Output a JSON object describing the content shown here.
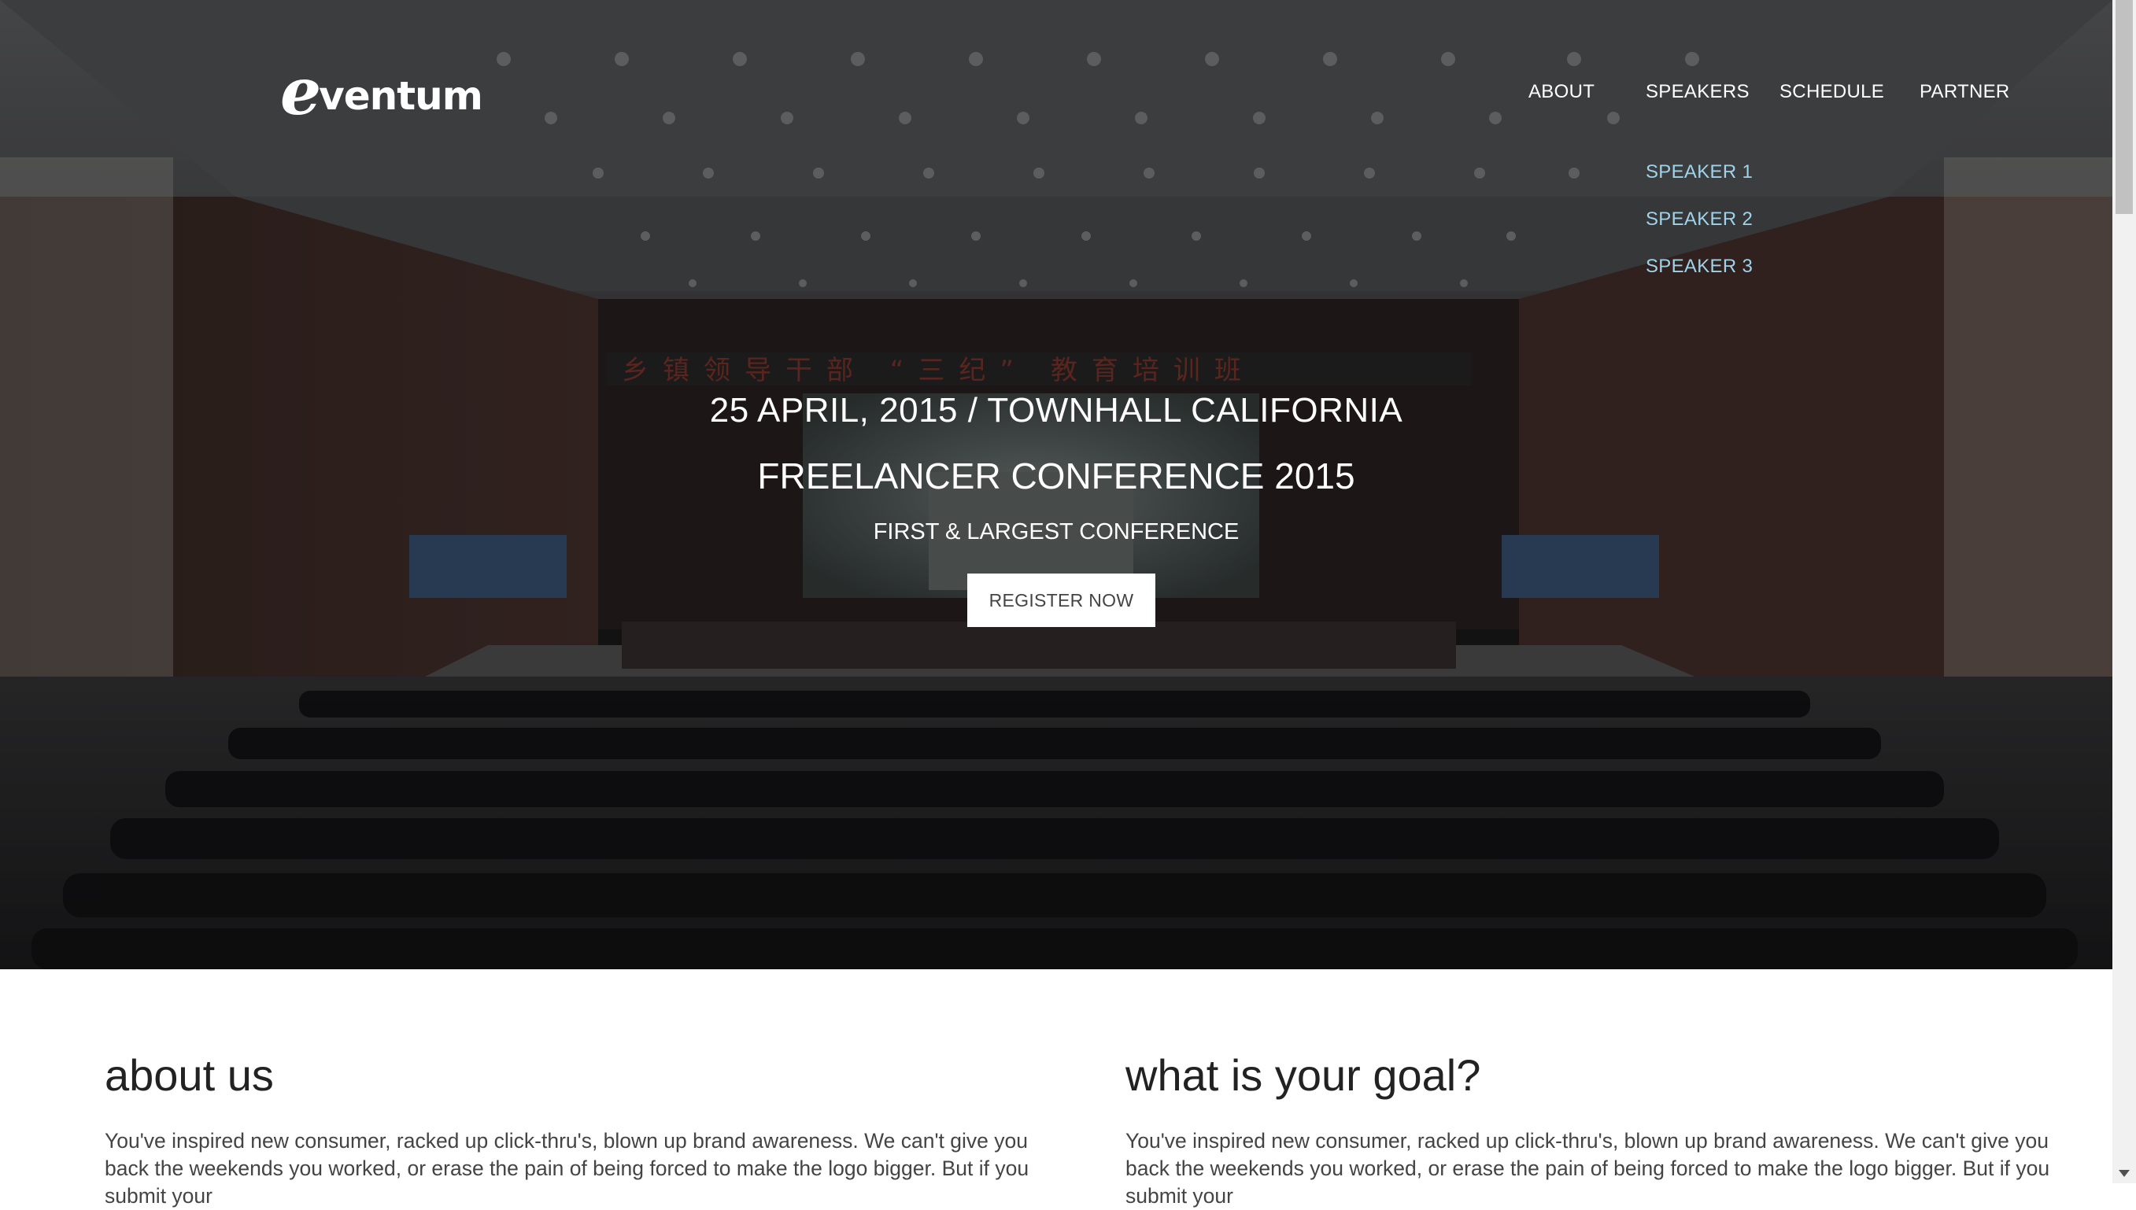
{
  "brand": {
    "logo_text": "ventum",
    "logo_initial": "e"
  },
  "nav": {
    "items": [
      {
        "label": "ABOUT"
      },
      {
        "label": "SPEAKERS"
      },
      {
        "label": "SCHEDULE"
      },
      {
        "label": "PARTNER"
      }
    ],
    "speakers_dropdown": [
      "SPEAKER 1",
      "SPEAKER 2",
      "SPEAKER 3"
    ]
  },
  "hero": {
    "date_location": "25 APRIL, 2015 / TOWNHALL CALIFORNIA",
    "title": "FREELANCER CONFERENCE 2015",
    "subtitle": "FIRST & LARGEST CONFERENCE",
    "cta_label": "REGISTER NOW",
    "background_banner_text": "乡镇领导干部 “三纪” 教育培训班"
  },
  "sections": {
    "about": {
      "heading": "about us",
      "body": "You've inspired new consumer, racked up click-thru's, blown up brand awareness. We can't give you back the weekends you worked, or erase the pain of being forced to make the logo bigger. But if you submit your"
    },
    "goal": {
      "heading": "what is your goal?",
      "body": "You've inspired new consumer, racked up click-thru's, blown up brand awareness. We can't give you back the weekends you worked, or erase the pain of being forced to make the logo bigger. But if you submit your"
    }
  },
  "colors": {
    "dropdown_link": "#9fd3ea",
    "hero_overlay": "#1c1c1e",
    "button_bg": "#ffffff"
  }
}
